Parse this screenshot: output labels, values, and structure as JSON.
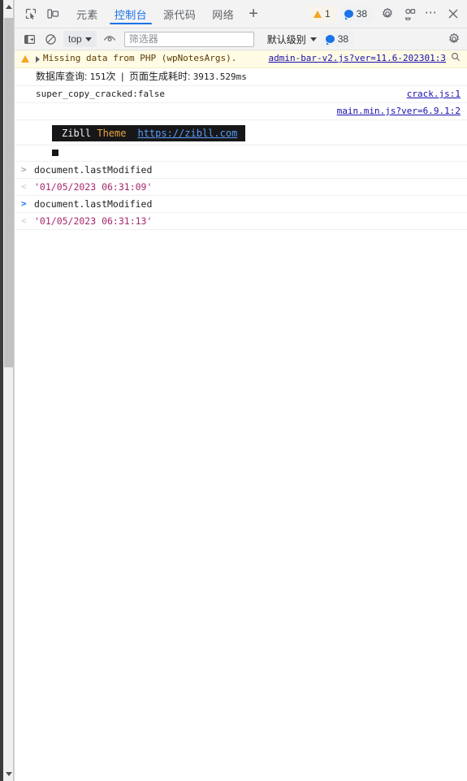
{
  "window": {
    "title": "DevTools Console"
  },
  "main_toolbar": {
    "inspect_icon": "inspect-element-icon",
    "device_icon": "device-toolbar-icon",
    "tabs": [
      {
        "label": "元素",
        "name": "tab-elements",
        "active": false
      },
      {
        "label": "控制台",
        "name": "tab-console",
        "active": true
      },
      {
        "label": "源代码",
        "name": "tab-sources",
        "active": false
      },
      {
        "label": "网络",
        "name": "tab-network",
        "active": false
      }
    ],
    "add_tab_label": "+",
    "warning_badge": {
      "icon": "warning-triangle-icon",
      "count": "1"
    },
    "message_badge": {
      "icon": "message-bubble-icon",
      "count": "38"
    },
    "settings_icon": "gear-icon",
    "customize_icon": "devices-settings-icon",
    "more_label": "⋯",
    "close_label": "✕"
  },
  "console_toolbar": {
    "sidebar_toggle_icon": "console-sidebar-icon",
    "clear_icon": "clear-console-icon",
    "context_label": "top",
    "live_expression_icon": "eye-icon",
    "filter_placeholder": "筛选器",
    "filter_value": "",
    "level_label": "默认级别",
    "level_badge": {
      "icon": "message-bubble-icon",
      "count": "38"
    },
    "settings_icon": "gear-icon"
  },
  "console_messages": [
    {
      "type": "warning",
      "icon": "warning-triangle-icon",
      "disclosure": "expand-triangle-icon",
      "text": "Missing data from PHP (wpNotesArgs).",
      "source_link": "admin-bar-v2.js?ver=11.6-202301:3",
      "search_icon": "magnifier-icon"
    },
    {
      "type": "log-cn",
      "text_parts": [
        {
          "text": "数据库查询: ",
          "mono": false
        },
        {
          "text": "151",
          "mono": true
        },
        {
          "text": "次",
          "mono": false
        },
        {
          "text": "  |  ",
          "mono": false
        },
        {
          "text": "页面生成耗时: ",
          "mono": false
        },
        {
          "text": "3913.529ms",
          "mono": true
        }
      ],
      "source_link": ""
    },
    {
      "type": "log",
      "text": "super_copy_cracked:false",
      "source_link": "crack.js:1"
    },
    {
      "type": "link-only",
      "text": "",
      "source_link": "main.min.js?ver=6.9.1:2"
    }
  ],
  "zibll_banner": {
    "label_left": "Zibll",
    "label_theme": "Theme",
    "url": "https://zibll.com"
  },
  "console_history": [
    {
      "kind": "command",
      "prompt": ">",
      "code": "document.lastModified",
      "current": false
    },
    {
      "kind": "result",
      "prompt": "<",
      "value": "'01/05/2023 06:31:09'"
    },
    {
      "kind": "command",
      "prompt": ">",
      "code": "document.lastModified",
      "current": true
    },
    {
      "kind": "result",
      "prompt": "<",
      "value": "'01/05/2023 06:31:13'"
    }
  ],
  "scrollbar": {
    "up_arrow": "scroll-up-arrow-icon",
    "down_arrow": "scroll-down-arrow-icon"
  },
  "colors": {
    "accent": "#1a73e8",
    "warning_bg": "#fffbe5",
    "warning_icon": "#f5a623",
    "link": "#1a0dab",
    "string_value": "#a6276e",
    "banner_bg": "#17171a",
    "banner_theme": "#e8a33d"
  }
}
